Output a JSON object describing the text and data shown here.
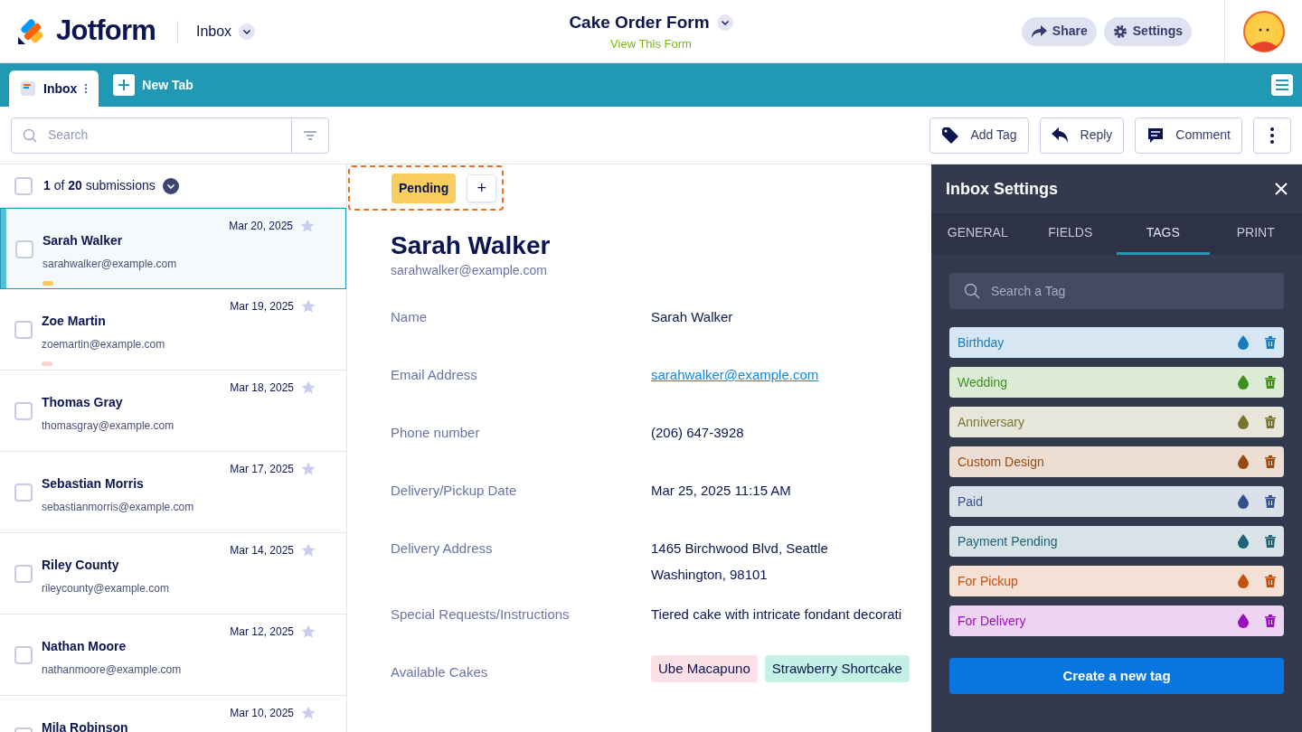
{
  "header": {
    "brand": "Jotform",
    "section": "Inbox",
    "form_title": "Cake Order Form",
    "view_link": "View This Form",
    "buttons": [
      "Share",
      "Settings"
    ]
  },
  "tabs": [
    {
      "label": "Inbox",
      "selected": true
    },
    {
      "label": "New Tab",
      "selected": false
    }
  ],
  "toolbar": {
    "search_placeholder": "Search",
    "actions": [
      {
        "kind": "tag",
        "label": "Add Tag"
      },
      {
        "kind": "reply",
        "label": "Reply"
      },
      {
        "kind": "comment",
        "label": "Comment"
      },
      {
        "kind": "more"
      }
    ]
  },
  "list": {
    "select_all_checked": false,
    "count": "**1** of **20** submissions",
    "items": [
      {
        "name": "Sarah Walker",
        "email": "sarahwalker@example.com",
        "date": "Mar 20, 2025",
        "selected": true,
        "checked": false,
        "starred": false,
        "color": "#f7cb5a"
      },
      {
        "name": "Zoe Martin",
        "email": "zoemartin@example.com",
        "date": "Mar 19, 2025",
        "selected": false,
        "checked": false,
        "starred": false,
        "color": "#fbd3cc"
      },
      {
        "name": "Thomas Gray",
        "email": "thomasgray@example.com",
        "date": "Mar 18, 2025",
        "selected": false,
        "checked": false,
        "starred": false
      },
      {
        "name": "Sebastian Morris",
        "email": "sebastianmorris@example.com",
        "date": "Mar 17, 2025",
        "selected": false,
        "checked": false,
        "starred": false
      },
      {
        "name": "Riley County",
        "email": "rileycounty@example.com",
        "date": "Mar 14, 2025",
        "selected": false,
        "checked": false,
        "starred": false
      },
      {
        "name": "Nathan Moore",
        "email": "nathanmoore@example.com",
        "date": "Mar 12, 2025",
        "selected": false,
        "checked": false,
        "starred": false
      },
      {
        "name": "Mila Robinson",
        "date": "Mar 10, 2025",
        "selected": false,
        "checked": false,
        "starred": false
      }
    ]
  },
  "detail": {
    "tag": "Pending",
    "add_tag": "+",
    "name": "Sarah Walker",
    "email": "sarahwalker@example.com",
    "fields": [
      {
        "kind": "text",
        "label": "Name",
        "value": "Sarah Walker"
      },
      {
        "kind": "link",
        "label": "Email Address",
        "value": "sarahwalker@example.com"
      },
      {
        "kind": "text",
        "label": "Phone number",
        "value": "(206) 647-3928"
      },
      {
        "kind": "text",
        "label": "Delivery/Pickup Date",
        "value": "Mar 25, 2025 11:15 AM"
      },
      {
        "kind": "lines",
        "label": "Delivery Address",
        "lines": [
          "1465 Birchwood Blvd, Seattle",
          "Washington, 98101"
        ]
      },
      {
        "kind": "text",
        "label": "Special Requests/Instructions",
        "value": "Tiered cake with intricate fondant decorati"
      },
      {
        "kind": "chips",
        "label": "Available Cakes",
        "chips": [
          {
            "label": "Ube Macapuno",
            "color": "#fde0e6"
          },
          {
            "label": "Strawberry Shortcake",
            "color": "#c4f1e5"
          }
        ]
      }
    ]
  },
  "settings": {
    "title": "Inbox Settings",
    "tabs": [
      {
        "label": "GENERAL",
        "selected": false
      },
      {
        "label": "FIELDS",
        "selected": false
      },
      {
        "label": "TAGS",
        "selected": true
      },
      {
        "label": "PRINT",
        "selected": false
      }
    ],
    "search_placeholder": "Search a Tag",
    "tags": [
      {
        "label": "Birthday",
        "color": "#1a7bbf"
      },
      {
        "label": "Wedding",
        "color": "#3f8f1b"
      },
      {
        "label": "Anniversary",
        "color": "#7a7430"
      },
      {
        "label": "Custom Design",
        "color": "#9a4a0f"
      },
      {
        "label": "Paid",
        "color": "#34508c"
      },
      {
        "label": "Payment Pending",
        "color": "#1e6376"
      },
      {
        "label": "For Pickup",
        "color": "#c4500e"
      },
      {
        "label": "For Delivery",
        "color": "#9a0fbf"
      }
    ],
    "create_button": "Create a new tag"
  }
}
